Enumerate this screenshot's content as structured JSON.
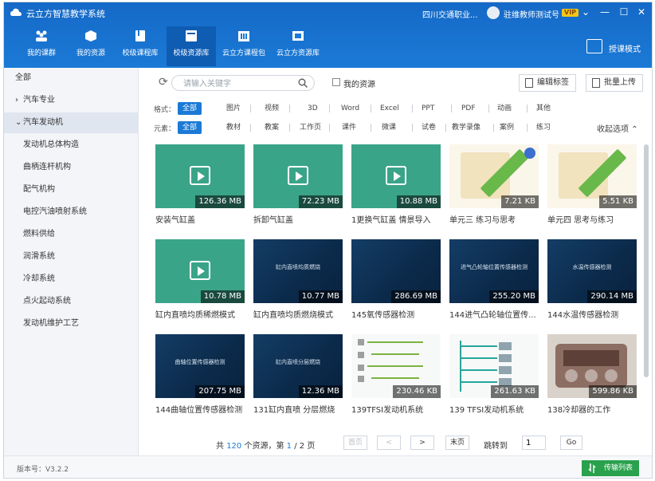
{
  "app": {
    "title": "云立方智慧教学系统"
  },
  "account": {
    "school": "四川交通职业...",
    "user": "驻维教师测试号",
    "vip": "VIP"
  },
  "nav": [
    {
      "label": "我的课群"
    },
    {
      "label": "我的资源"
    },
    {
      "label": "校级课程库"
    },
    {
      "label": "校级资源库"
    },
    {
      "label": "云立方课程包"
    },
    {
      "label": "云立方资源库"
    }
  ],
  "teach_mode": "授课模式",
  "sidebar": {
    "items": [
      {
        "label": "全部"
      },
      {
        "label": "汽车专业"
      },
      {
        "label": "汽车发动机"
      },
      {
        "label": "发动机总体构造"
      },
      {
        "label": "曲柄连杆机构"
      },
      {
        "label": "配气机构"
      },
      {
        "label": "电控汽油喷射系统"
      },
      {
        "label": "燃料供给"
      },
      {
        "label": "润滑系统"
      },
      {
        "label": "冷却系统"
      },
      {
        "label": "点火起动系统"
      },
      {
        "label": "发动机维护工艺"
      }
    ]
  },
  "toolbar": {
    "search_placeholder": "请输入关键字",
    "my_resources": "我的资源",
    "edit_tags": "编辑标签",
    "batch_upload": "批量上传"
  },
  "filters": {
    "format_label": "格式：",
    "formats": [
      "全部",
      "图片",
      "视频",
      "3D",
      "Word",
      "Excel",
      "PPT",
      "PDF",
      "动画",
      "其他"
    ],
    "element_label": "元素：",
    "elements": [
      "全部",
      "教材",
      "教案",
      "工作页",
      "课件",
      "微课",
      "试卷",
      "教学录像",
      "案例",
      "练习"
    ],
    "collapse": "收起选项"
  },
  "resources": [
    {
      "title": "安装气缸盖",
      "size": "126.36 MB",
      "thumb_title": ""
    },
    {
      "title": "拆卸气缸盖",
      "size": "72.23 MB",
      "thumb_title": ""
    },
    {
      "title": "1更换气缸盖 情景导入",
      "size": "10.88 MB",
      "thumb_title": ""
    },
    {
      "title": "单元三 练习与思考",
      "size": "7.21 KB",
      "thumb_title": ""
    },
    {
      "title": "单元四 思考与练习",
      "size": "5.51 KB",
      "thumb_title": ""
    },
    {
      "title": "缸内直喷均质稀燃模式",
      "size": "10.78 MB",
      "thumb_title": ""
    },
    {
      "title": "缸内直喷均质燃烧模式",
      "size": "10.77 MB",
      "thumb_title": "缸内直喷均质燃烧"
    },
    {
      "title": "145氧传感器检测",
      "size": "286.69 MB",
      "thumb_title": ""
    },
    {
      "title": "144进气凸轮轴位置传...",
      "size": "255.20 MB",
      "thumb_title": "进气凸轮轴位置传感器检测"
    },
    {
      "title": "144水温传感器检测",
      "size": "290.14 MB",
      "thumb_title": "水温传感器检测"
    },
    {
      "title": "144曲轴位置传感器检测",
      "size": "207.75 MB",
      "thumb_title": "曲轴位置传感器检测"
    },
    {
      "title": "131缸内直喷 分层燃烧",
      "size": "12.36 MB",
      "thumb_title": "缸内直喷分层燃烧"
    },
    {
      "title": "139TFSI发动机系统",
      "size": "230.46 KB",
      "thumb_title": ""
    },
    {
      "title": "139 TFSI发动机系统",
      "size": "261.63 KB",
      "thumb_title": ""
    },
    {
      "title": "138冷却器的工作",
      "size": "599.86 KB",
      "thumb_title": ""
    }
  ],
  "pagination": {
    "prefix": "共",
    "total": "120",
    "mid": "个资源，第",
    "page": "1",
    "slash": "/",
    "pages": "2",
    "suffix": "页",
    "first": "首页",
    "prev": "<",
    "next": ">",
    "last": "末页",
    "jump_label": "跳转到",
    "jump_value": "1",
    "go": "Go"
  },
  "footer": {
    "version": "版本号：V3.2.2",
    "transfer": "传输列表"
  },
  "colors": {
    "header": "#1b7ad6",
    "active": "#1b7ad6",
    "video": "#3aa489",
    "transfer": "#2aa14d"
  }
}
